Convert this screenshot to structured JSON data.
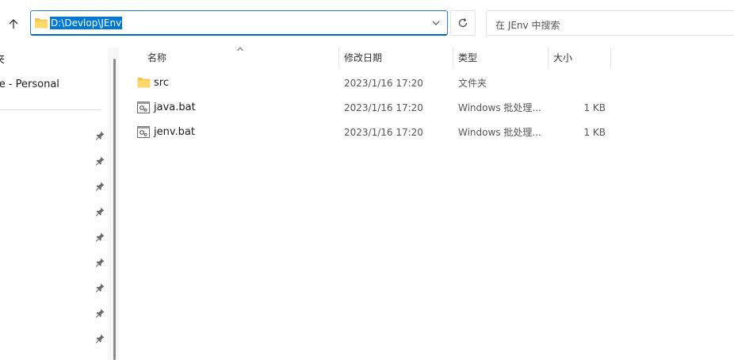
{
  "addressbar": {
    "path": "D:\\Devlop\\JEnv"
  },
  "search": {
    "placeholder": "在 JEnv 中搜索"
  },
  "nav": {
    "items": [
      {
        "label": "夹"
      },
      {
        "label": "ve - Personal"
      }
    ],
    "pinned_count": 9
  },
  "columns": {
    "name": "名称",
    "date": "修改日期",
    "type": "类型",
    "size": "大小"
  },
  "files": [
    {
      "name": "src",
      "date": "2023/1/16 17:20",
      "type": "文件夹",
      "size": "",
      "icon": "folder-icon"
    },
    {
      "name": "java.bat",
      "date": "2023/1/16 17:20",
      "type": "Windows 批处理...",
      "size": "1 KB",
      "icon": "batch-file-icon"
    },
    {
      "name": "jenv.bat",
      "date": "2023/1/16 17:20",
      "type": "Windows 批处理...",
      "size": "1 KB",
      "icon": "batch-file-icon"
    }
  ],
  "colors": {
    "accent": "#0067c0",
    "selection": "#0078d7",
    "folder": "#f8c549"
  }
}
